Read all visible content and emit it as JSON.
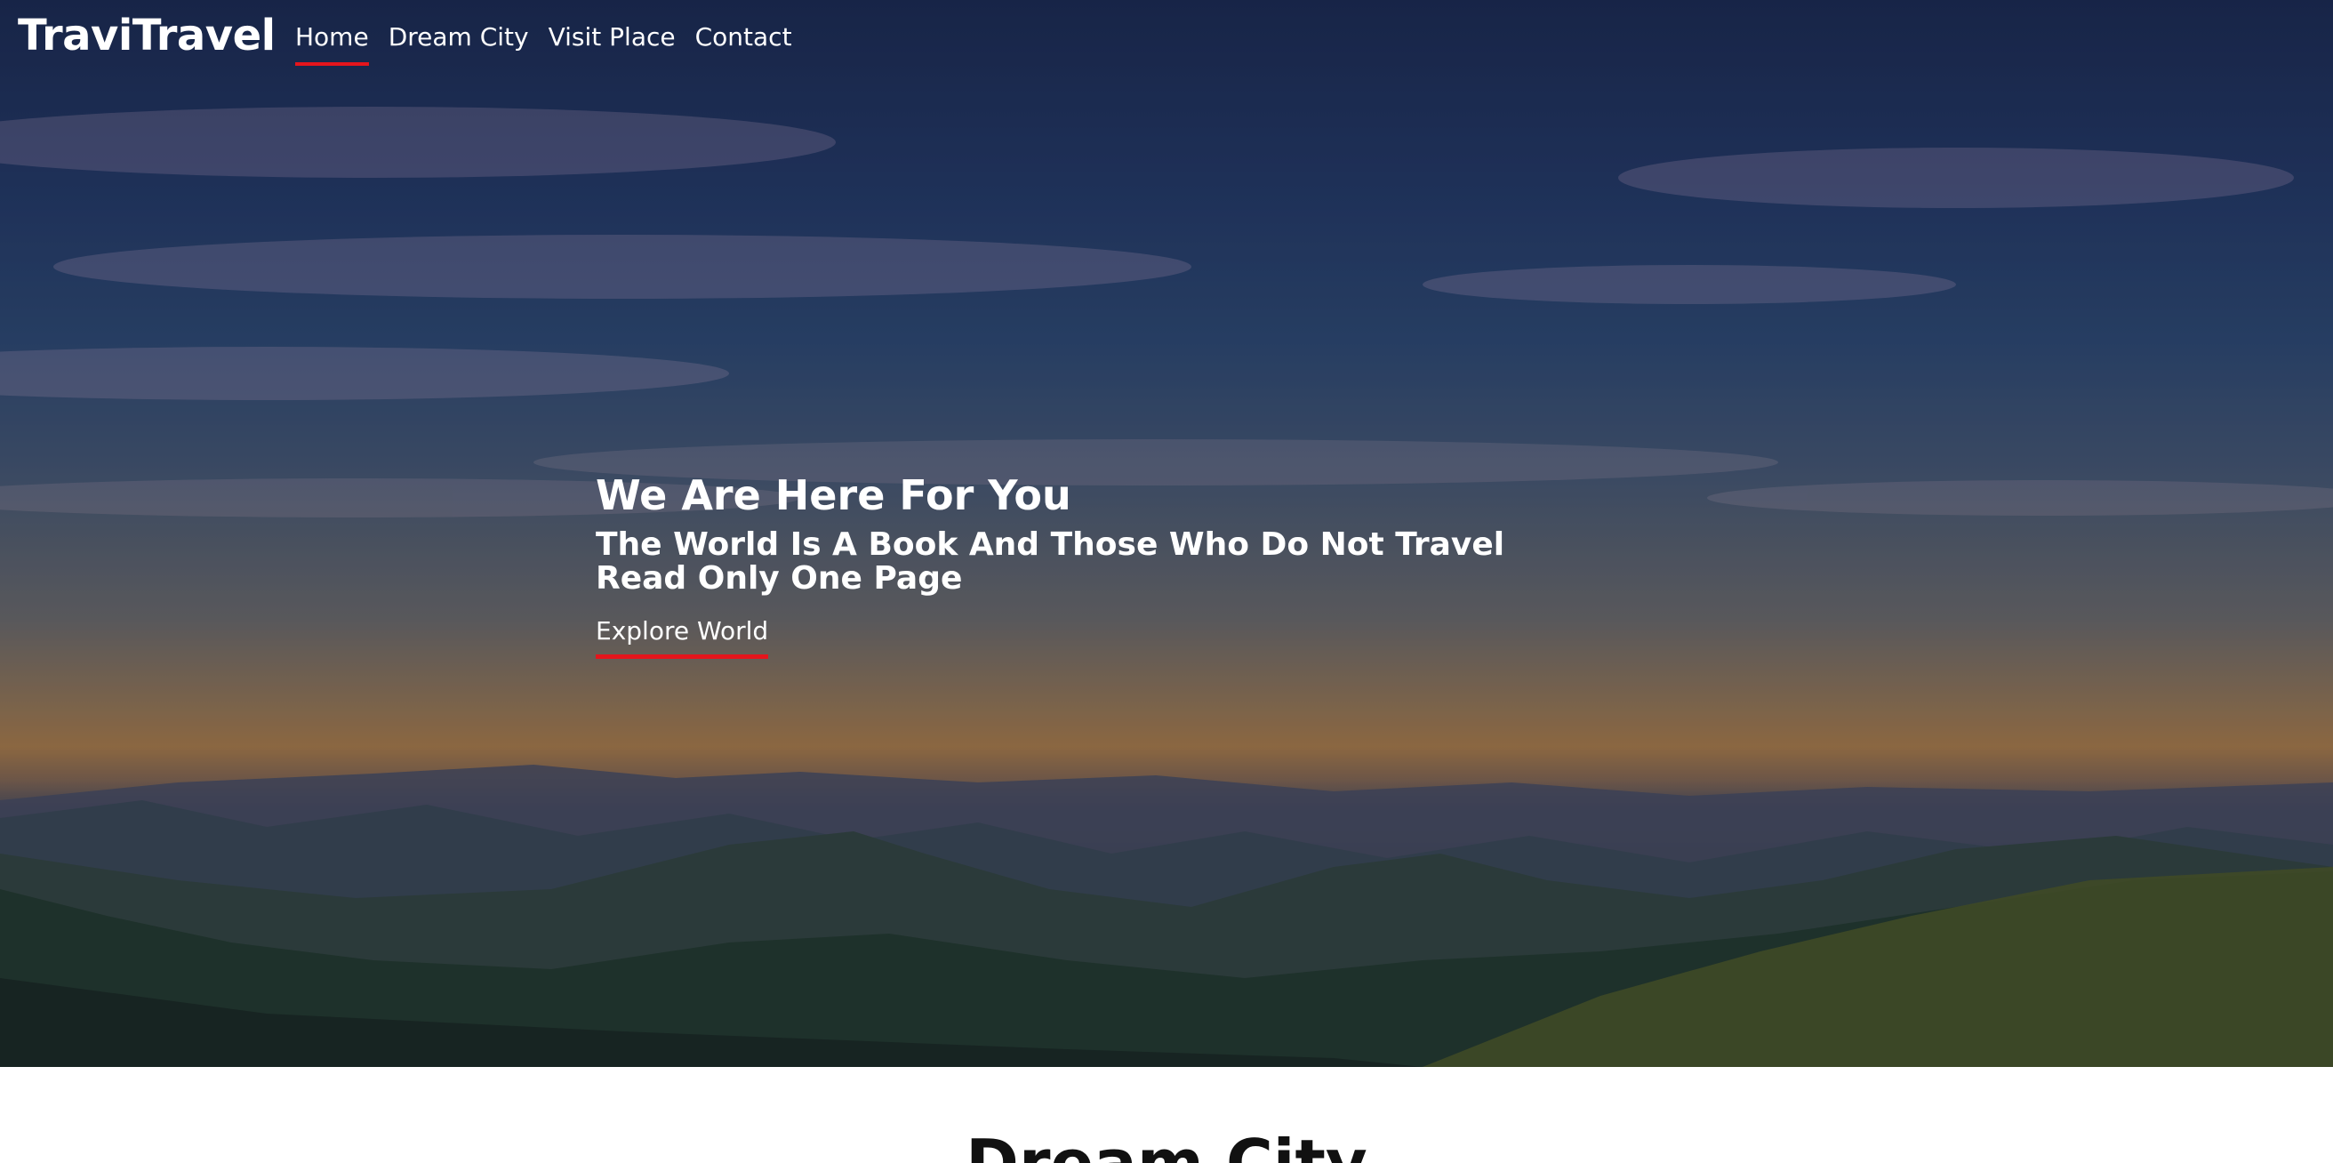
{
  "brand": {
    "name": "TraviTravel"
  },
  "nav": {
    "items": [
      {
        "label": "Home",
        "active": true
      },
      {
        "label": "Dream City",
        "active": false
      },
      {
        "label": "Visit Place",
        "active": false
      },
      {
        "label": "Contact",
        "active": false
      }
    ]
  },
  "hero": {
    "title": "We Are Here For You",
    "subtitle": "The World Is A Book And Those Who Do Not Travel Read Only One Page",
    "cta_label": "Explore World"
  },
  "section": {
    "title": "Dream City"
  },
  "colors": {
    "accent": "#e5151c",
    "text_light": "#ffffff",
    "text_dark": "#111111"
  }
}
